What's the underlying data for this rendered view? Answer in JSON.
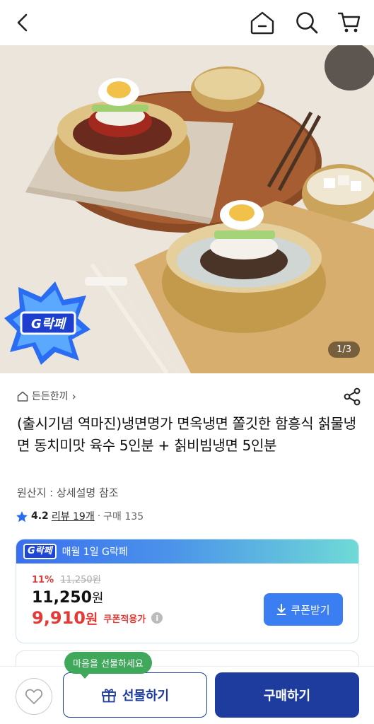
{
  "header": {
    "icons": [
      "back-arrow-icon",
      "home-icon",
      "search-icon",
      "cart-icon"
    ]
  },
  "gallery": {
    "counter": "1/3",
    "badge_text": "G락페"
  },
  "store": {
    "name": "든든한끼",
    "chevron": "›"
  },
  "product": {
    "title": "(출시기념 역마진)냉면명가 면옥냉면 쫄깃한 함흥식 칡물냉면 동치미맛 육수 5인분 + 칡비빔냉면 5인분",
    "origin": "원산지 : 상세설명 참조",
    "rating": "4.2",
    "reviews": "리뷰 19개",
    "separator": "·",
    "purchases": "구매 135"
  },
  "price_card": {
    "logo": "G락페",
    "banner_text": "매월 1일 G락페",
    "discount_percent": "11%",
    "original_price": "11,250원",
    "price_number": "11,250",
    "price_unit": "원",
    "coupon_price_number": "9,910",
    "coupon_price_unit": "원",
    "coupon_label": "쿠폰적용가",
    "info": "i",
    "coupon_button": "쿠폰받기"
  },
  "bottom_bar": {
    "tooltip": "마음을 선물하세요",
    "gift_button": "선물하기",
    "buy_button": "구매하기"
  },
  "colors": {
    "primary": "#1d3c9e",
    "accent_blue": "#3b7ef2",
    "sale_red": "#e53935",
    "tooltip_green": "#3fa85b"
  }
}
